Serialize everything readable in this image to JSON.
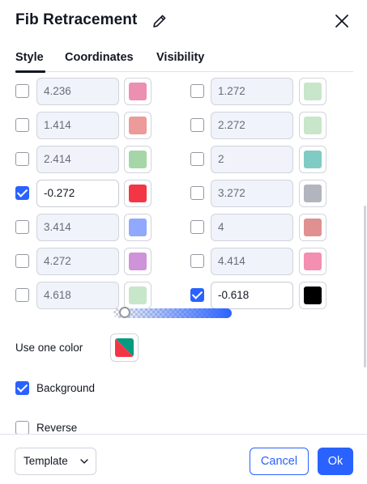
{
  "dialog": {
    "title": "Fib Retracement"
  },
  "tabs": [
    {
      "label": "Style",
      "active": true
    },
    {
      "label": "Coordinates",
      "active": false
    },
    {
      "label": "Visibility",
      "active": false
    }
  ],
  "levels_left": [
    {
      "value": "4.236",
      "checked": false,
      "color": "#ec8fb0"
    },
    {
      "value": "1.414",
      "checked": false,
      "color": "#ec9a9a"
    },
    {
      "value": "2.414",
      "checked": false,
      "color": "#a5d6a7"
    },
    {
      "value": "-0.272",
      "checked": true,
      "color": "#f23645"
    },
    {
      "value": "3.414",
      "checked": false,
      "color": "#91a8ff"
    },
    {
      "value": "4.272",
      "checked": false,
      "color": "#ce93d8"
    },
    {
      "value": "4.618",
      "checked": false,
      "color": "#c8e6c9"
    }
  ],
  "levels_right": [
    {
      "value": "1.272",
      "checked": false,
      "color": "#c8e6c9"
    },
    {
      "value": "2.272",
      "checked": false,
      "color": "#c8e6c9"
    },
    {
      "value": "2",
      "checked": false,
      "color": "#80cbc4"
    },
    {
      "value": "3.272",
      "checked": false,
      "color": "#b2b5be"
    },
    {
      "value": "4",
      "checked": false,
      "color": "#e09090"
    },
    {
      "value": "4.414",
      "checked": false,
      "color": "#f48fb1"
    },
    {
      "value": "-0.618",
      "checked": true,
      "color": "#000000"
    }
  ],
  "options": {
    "use_one_color_label": "Use one color",
    "one_color_colors": [
      "#089981",
      "#f23645"
    ],
    "background_label": "Background",
    "background_checked": true,
    "background_opacity_percent": 5,
    "reverse_label": "Reverse",
    "reverse_checked": false
  },
  "footer": {
    "template_label": "Template",
    "cancel_label": "Cancel",
    "ok_label": "Ok"
  },
  "colors": {
    "accent": "#2962ff"
  }
}
